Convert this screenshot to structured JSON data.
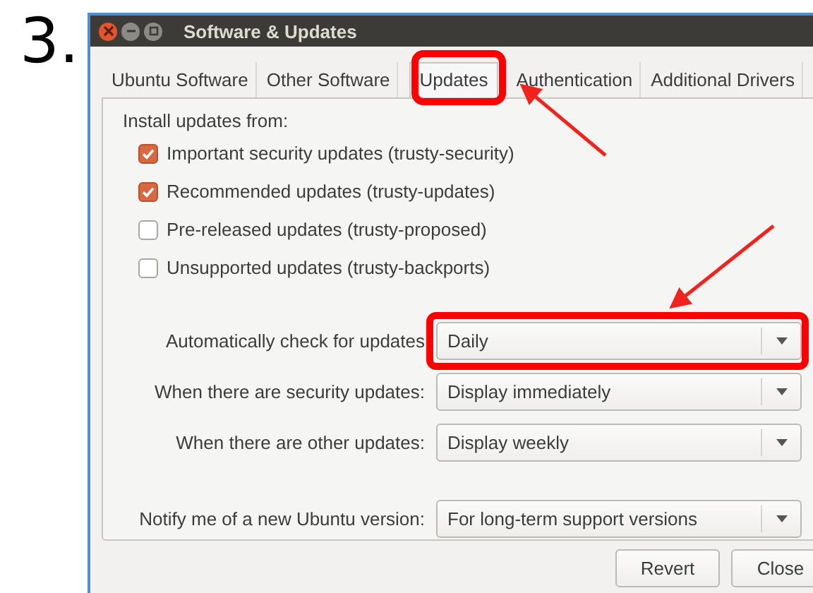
{
  "step": "3.",
  "window": {
    "title": "Software & Updates"
  },
  "tabs": [
    {
      "label": "Ubuntu Software",
      "selected": false
    },
    {
      "label": "Other Software",
      "selected": false
    },
    {
      "label": "Updates",
      "selected": true
    },
    {
      "label": "Authentication",
      "selected": false
    },
    {
      "label": "Additional Drivers",
      "selected": false
    }
  ],
  "install_heading": "Install updates from:",
  "sources": [
    {
      "label": "Important security updates (trusty-security)",
      "checked": true
    },
    {
      "label": "Recommended updates (trusty-updates)",
      "checked": true
    },
    {
      "label": "Pre-released updates (trusty-proposed)",
      "checked": false
    },
    {
      "label": "Unsupported updates (trusty-backports)",
      "checked": false
    }
  ],
  "settings": [
    {
      "label": "Automatically check for updates",
      "value": "Daily",
      "highlighted": true
    },
    {
      "label": "When there are security updates:",
      "value": "Display immediately",
      "highlighted": false
    },
    {
      "label": "When there are other updates:",
      "value": "Display weekly",
      "highlighted": false
    },
    {
      "label": "Notify me of a new Ubuntu version:",
      "value": "For long-term support versions",
      "highlighted": false
    }
  ],
  "buttons": [
    "Revert",
    "Close"
  ]
}
